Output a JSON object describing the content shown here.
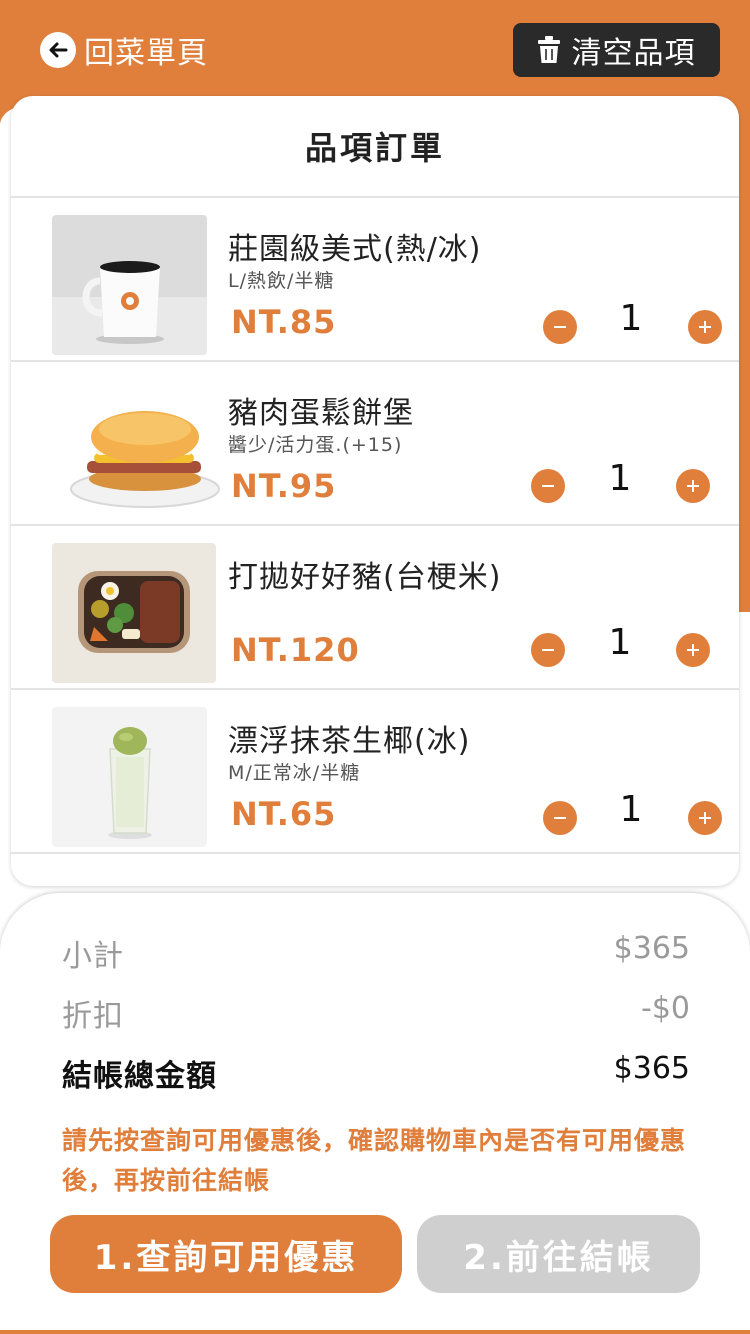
{
  "colors": {
    "accent": "#e07f3c",
    "dark": "#2a2a2a",
    "disabled": "#cfcfcf"
  },
  "header": {
    "back_label": "回菜單頁",
    "back_icon": "arrow-left-icon",
    "clear_label": "清空品項",
    "clear_icon": "trash-icon"
  },
  "order": {
    "title": "品項訂單",
    "items": [
      {
        "name": "莊園級美式(熱/冰)",
        "options": "L/熱飲/半糖",
        "price": "NT.85",
        "qty": "1",
        "image": "coffee-cup"
      },
      {
        "name": "豬肉蛋鬆餅堡",
        "options": "醬少/活力蛋.(+15)",
        "price": "NT.95",
        "qty": "1",
        "image": "pancake-burger"
      },
      {
        "name": "打拋好好豬(台梗米)",
        "options": "",
        "price": "NT.120",
        "qty": "1",
        "image": "rice-bowl"
      },
      {
        "name": "漂浮抹茶生椰(冰)",
        "options": "M/正常冰/半糖",
        "price": "NT.65",
        "qty": "1",
        "image": "matcha-float"
      }
    ]
  },
  "summary": {
    "subtotal_label": "小計",
    "subtotal_value": "$365",
    "discount_label": "折扣",
    "discount_value": "-$0",
    "total_label": "結帳總金額",
    "total_value": "$365",
    "notice": "請先按查詢可用優惠後，確認購物車內是否有可用優惠後，再按前往結帳",
    "coupon_button": "1.查詢可用優惠",
    "checkout_button": "2.前往結帳"
  }
}
